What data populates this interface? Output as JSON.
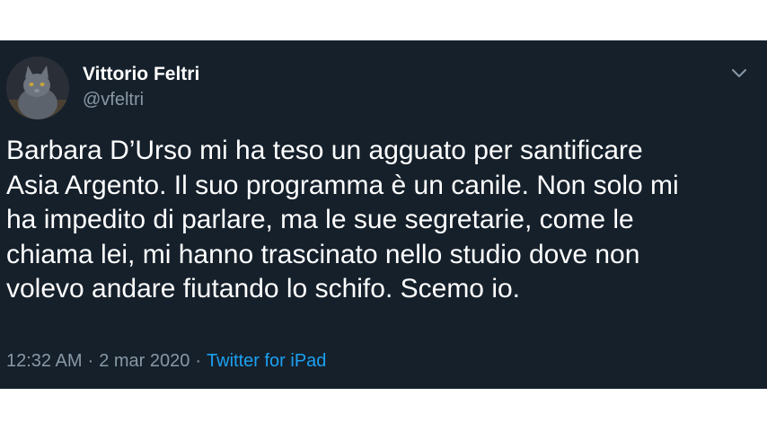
{
  "tweet": {
    "author": {
      "name": "Vittorio Feltri",
      "handle": "@vfeltri",
      "avatar_icon": "cat-avatar-icon"
    },
    "menu_icon": "chevron-down-icon",
    "text_lines": [
      "Barbara D’Urso mi ha teso un agguato per santificare",
      "Asia Argento. Il suo programma è un canile. Non solo mi",
      "ha impedito di parlare, ma le sue segretarie, come le",
      "chiama lei, mi hanno trascinato nello studio dove non",
      "volevo andare fiutando lo schifo. Scemo io."
    ],
    "time": "12:32 AM",
    "date": "2 mar 2020",
    "separator": "·",
    "source": "Twitter for iPad"
  },
  "colors": {
    "card_background": "#15202b",
    "text_primary": "#ffffff",
    "text_secondary": "#8899a6",
    "link": "#1da1f2"
  }
}
